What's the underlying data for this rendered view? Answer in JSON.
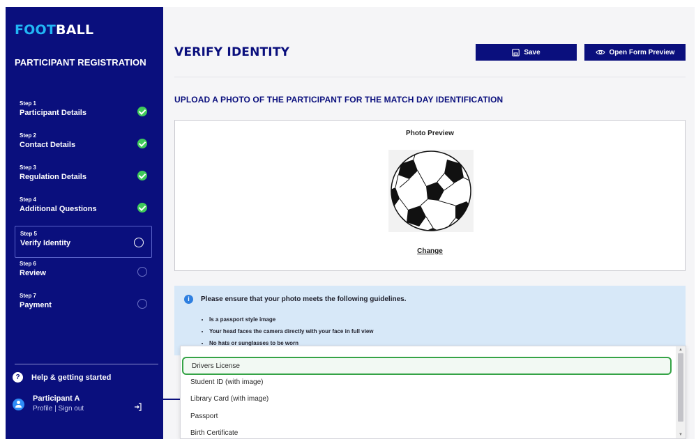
{
  "brand": {
    "logo_part1": "FOOT",
    "logo_part2": "BALL",
    "logo_colors": {
      "part1": "#21b6f5",
      "part2": "#ffffff"
    }
  },
  "sidebar": {
    "title": "PARTICIPANT REGISTRATION",
    "background": "#0a0f7d",
    "steps": [
      {
        "num": "Step 1",
        "label": "Participant Details",
        "status": "complete"
      },
      {
        "num": "Step 2",
        "label": "Contact Details",
        "status": "complete"
      },
      {
        "num": "Step 3",
        "label": "Regulation Details",
        "status": "complete"
      },
      {
        "num": "Step 4",
        "label": "Additional Questions",
        "status": "complete"
      },
      {
        "num": "Step 5",
        "label": "Verify Identity",
        "status": "current"
      },
      {
        "num": "Step 6",
        "label": "Review",
        "status": "pending"
      },
      {
        "num": "Step 7",
        "label": "Payment",
        "status": "pending"
      }
    ],
    "help_label": "Help & getting started",
    "user": {
      "name": "Participant A",
      "links": "Profile | Sign out"
    }
  },
  "main": {
    "title": "VERIFY IDENTITY",
    "save_label": "Save",
    "preview_label": "Open Form Preview",
    "section_heading": "UPLOAD A PHOTO OF THE PARTICIPANT FOR THE MATCH DAY IDENTIFICATION",
    "photo": {
      "label": "Photo Preview",
      "change_label": "Change"
    },
    "guidelines": {
      "heading": "Please ensure that your photo meets the following guidelines.",
      "items": [
        "Is a passport style image",
        "Your head faces the camera directly with your face in full view",
        "No hats or sunglasses to be worn"
      ]
    }
  },
  "dropdown": {
    "options": [
      "Drivers License",
      "Student ID (with image)",
      "Library Card (with image)",
      "Passport",
      "Birth Certificate"
    ],
    "selected": "Drivers License",
    "highlight_color": "#35a346"
  }
}
